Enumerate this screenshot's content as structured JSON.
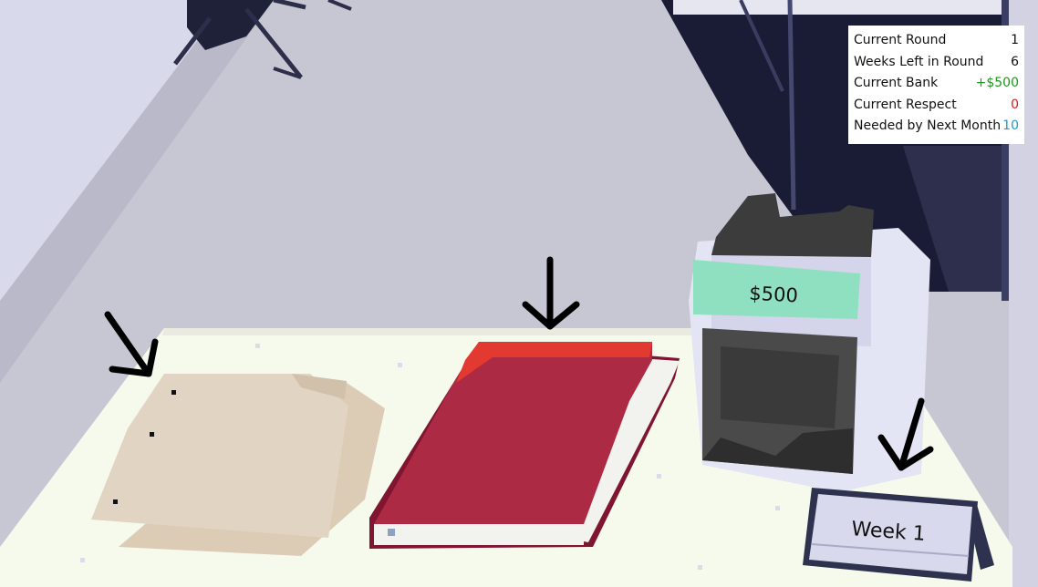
{
  "stats": {
    "current_round": {
      "label": "Current Round",
      "value": "1"
    },
    "weeks_left": {
      "label": "Weeks Left in Round",
      "value": "6"
    },
    "current_bank": {
      "label": "Current Bank",
      "value": "+$500",
      "color": "#1a9a1a"
    },
    "current_respect": {
      "label": "Current Respect",
      "value": "0",
      "color": "#e01818"
    },
    "needed_next_month": {
      "label": "Needed by Next Month",
      "value": "10",
      "color": "#1c9ad6"
    }
  },
  "money_counter": {
    "display": "$500",
    "display_color": "#8fe0c0"
  },
  "week_sign": {
    "label": "Week 1"
  },
  "desk_items": [
    "paper-stack",
    "red-ledger-book",
    "money-counter",
    "week-sign"
  ],
  "colors": {
    "floor": "#c5c5d1",
    "desk": "#f7fbee",
    "ledger_red": "#ad2b45",
    "papers": "#e0d2c0"
  }
}
